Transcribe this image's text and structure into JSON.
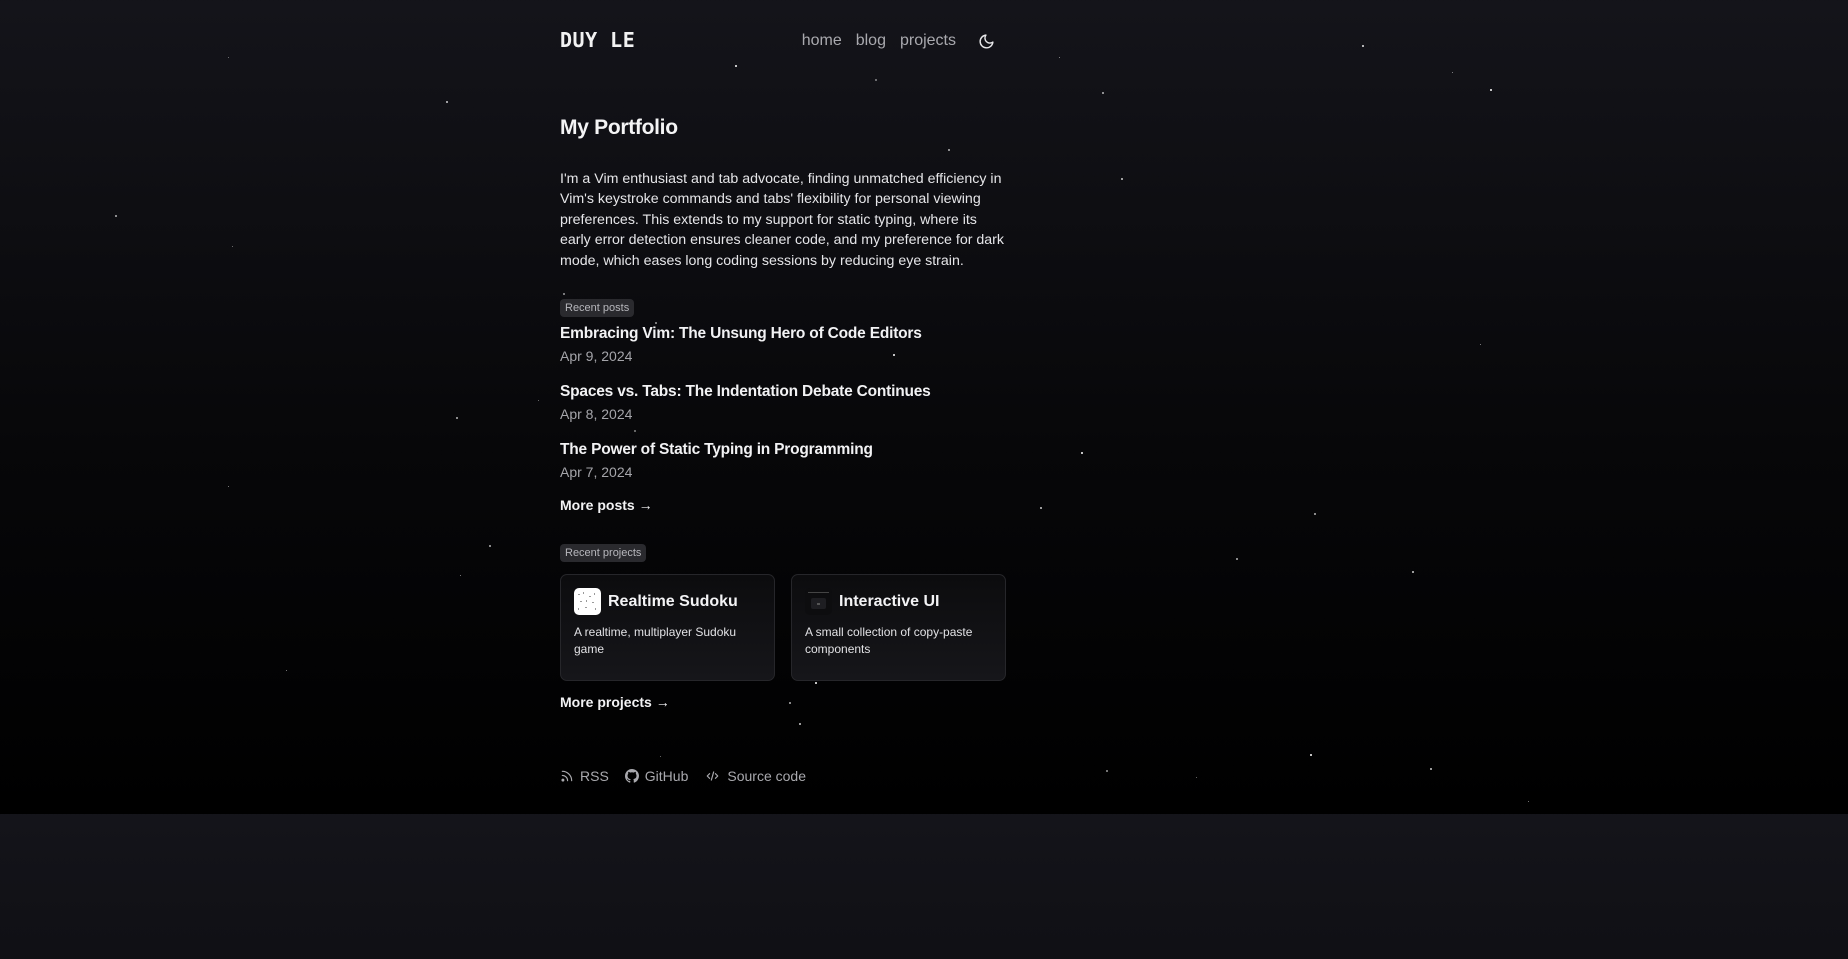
{
  "header": {
    "logo": "DUY LE",
    "nav": {
      "home": "home",
      "blog": "blog",
      "projects": "projects"
    },
    "theme_icon": "moon-icon"
  },
  "main": {
    "title": "My Portfolio",
    "intro": "I'm a Vim enthusiast and tab advocate, finding unmatched efficiency in Vim's keystroke commands and tabs' flexibility for personal viewing preferences. This extends to my support for static typing, where its early error detection ensures cleaner code, and my preference for dark mode, which eases long coding sessions by reducing eye strain."
  },
  "recent_posts": {
    "label": "Recent posts",
    "posts": [
      {
        "title": "Embracing Vim: The Unsung Hero of Code Editors",
        "date": "Apr 9, 2024"
      },
      {
        "title": "Spaces vs. Tabs: The Indentation Debate Continues",
        "date": "Apr 8, 2024"
      },
      {
        "title": "The Power of Static Typing in Programming",
        "date": "Apr 7, 2024"
      }
    ],
    "more": "More posts →"
  },
  "recent_projects": {
    "label": "Recent projects",
    "projects": [
      {
        "title": "Realtime Sudoku",
        "description": "A realtime, multiplayer Sudoku game",
        "icon": "sudoku-app-icon"
      },
      {
        "title": "Interactive UI",
        "description": "A small collection of copy-paste components",
        "icon": "interactive-ui-app-icon"
      }
    ],
    "more": "More projects →"
  },
  "footer": {
    "links": [
      {
        "label": "RSS",
        "icon": "rss-icon"
      },
      {
        "label": "GitHub",
        "icon": "github-icon"
      },
      {
        "label": "Source code",
        "icon": "code-icon"
      }
    ]
  },
  "colors": {
    "background_top": "#14141a",
    "background_bottom": "#000000",
    "text": "#f2f2f4",
    "muted": "#a9a9ae",
    "badge_bg": "#2a2a2e"
  }
}
